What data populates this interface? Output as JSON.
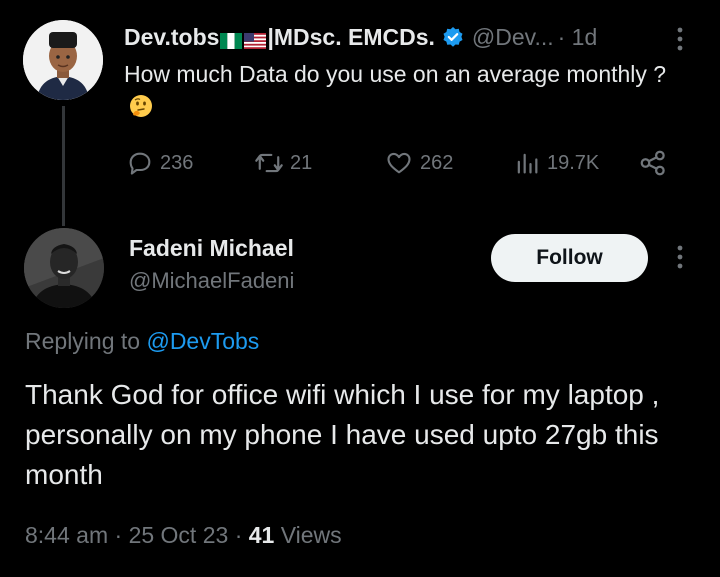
{
  "parent_tweet": {
    "display_name": "Dev.tobs",
    "display_name_suffix": "|MDsc. EMCDs.",
    "handle": "@Dev...",
    "time": "· 1d",
    "text": "How much Data do you use  on an average monthly ?",
    "emoji_icon": "thinking-face-icon",
    "stats": {
      "replies": "236",
      "retweets": "21",
      "likes": "262",
      "views": "19.7K"
    }
  },
  "reply_tweet": {
    "display_name": "Fadeni Michael",
    "handle": "@MichaelFadeni",
    "follow_label": "Follow",
    "replying_prefix": "Replying to",
    "replying_mention": "@DevTobs",
    "text": "Thank God for office wifi which I use for my laptop , personally on my phone I have used upto 27gb this month",
    "time": "8:44 am",
    "date": "25 Oct 23",
    "separator": "·",
    "views_count": "41",
    "views_label": "Views"
  },
  "colors": {
    "background": "#000000",
    "text_primary": "#e7e9ea",
    "text_secondary": "#71767b",
    "accent": "#1d9bf0",
    "follow_bg": "#eff3f4"
  }
}
